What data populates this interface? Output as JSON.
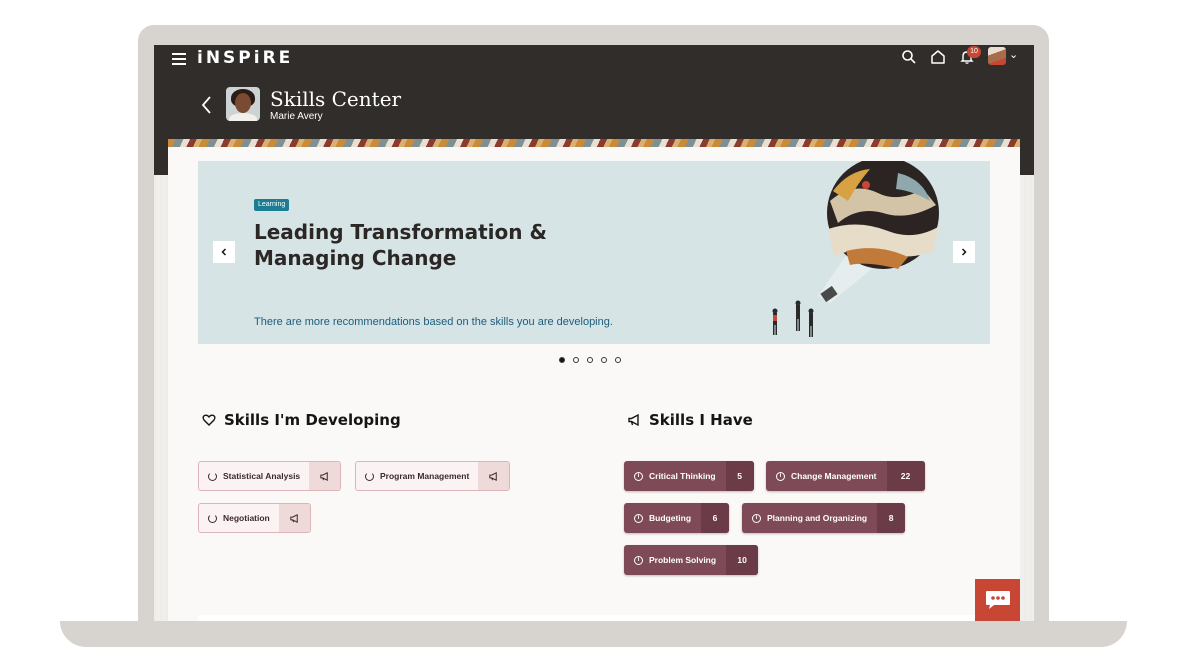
{
  "header": {
    "brand": "iNSPiRE",
    "notification_count": "10",
    "page_title": "Skills Center",
    "user_name": "Marie Avery"
  },
  "hero": {
    "badge": "Learning",
    "title": "Leading Transformation & Managing Change",
    "text": "There are more recommendations based on the skills you are developing.",
    "slides": 5,
    "active_slide": 1
  },
  "developing": {
    "title": "Skills I'm Developing",
    "items": [
      {
        "label": "Statistical Analysis"
      },
      {
        "label": "Program Management"
      },
      {
        "label": "Negotiation"
      }
    ]
  },
  "have": {
    "title": "Skills I Have",
    "items": [
      {
        "label": "Critical Thinking",
        "count": "5"
      },
      {
        "label": "Change Management",
        "count": "22"
      },
      {
        "label": "Budgeting",
        "count": "6"
      },
      {
        "label": "Planning and Organizing",
        "count": "8"
      },
      {
        "label": "Problem Solving",
        "count": "10"
      }
    ]
  },
  "colors": {
    "header_bg": "#312d2a",
    "hero_bg": "#d6e4e6",
    "badge_bg": "#1c7d92",
    "skill_have_bg": "#7f4a57",
    "chat_bg": "#c74634"
  }
}
